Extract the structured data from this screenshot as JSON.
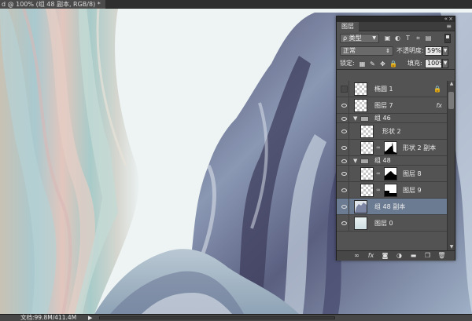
{
  "document": {
    "tab_title": "d @ 100% (组 48 副本, RGB/8) *",
    "size_info": "文档:99.8M/411.4M"
  },
  "layers_panel": {
    "tab_label": "图层",
    "filter": {
      "kind_label": "ρ 类型"
    },
    "blend_mode": "正常",
    "opacity_label": "不透明度:",
    "opacity_value": "59%",
    "lock_label": "锁定:",
    "fill_label": "填充:",
    "fill_value": "100%",
    "layers": [
      {
        "name": "椭圆 1",
        "type": "layer",
        "visible": false,
        "locked": true
      },
      {
        "name": "图层 7",
        "type": "layer",
        "visible": true,
        "fx": true
      },
      {
        "name": "组 46",
        "type": "group",
        "visible": true,
        "expanded": true
      },
      {
        "name": "形状 2",
        "type": "layer",
        "visible": true,
        "indent": true
      },
      {
        "name": "形状 2 副本",
        "type": "layer",
        "visible": true,
        "indent": true,
        "mask": true
      },
      {
        "name": "组 48",
        "type": "group",
        "visible": true,
        "expanded": true
      },
      {
        "name": "图层 8",
        "type": "layer",
        "visible": true,
        "indent": true,
        "mask": true
      },
      {
        "name": "图层 9",
        "type": "layer",
        "visible": true,
        "indent": true,
        "mask": true
      },
      {
        "name": "组 48 副本",
        "type": "layer",
        "visible": true,
        "selected": true
      },
      {
        "name": "图层 0",
        "type": "layer",
        "visible": true
      }
    ],
    "footer_buttons": [
      "link-layers-icon",
      "fx-icon",
      "add-mask-icon",
      "adjustment-layer-icon",
      "new-group-icon",
      "new-layer-icon",
      "delete-layer-icon"
    ]
  },
  "colors": {
    "panel_bg": "#535353",
    "selected_row": "#6b7b92",
    "canvas_bg": "#eef4f4"
  }
}
